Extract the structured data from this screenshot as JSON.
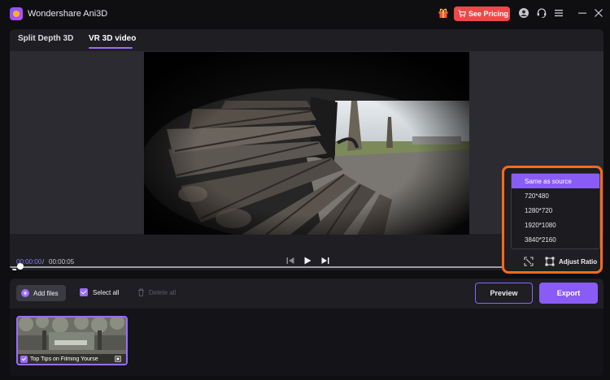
{
  "app": {
    "title": "Wondershare Ani3D",
    "pricing_label": "See Pricing"
  },
  "tabs": [
    {
      "label": "Split Depth 3D",
      "active": false
    },
    {
      "label": "VR 3D video",
      "active": true
    }
  ],
  "player": {
    "current_time": "00:00:00",
    "separator": "/",
    "total_time": "00:00:05",
    "progress": 0.0
  },
  "resolution_menu": {
    "options": [
      "Same as source",
      "720*480",
      "1280*720",
      "1920*1080",
      "3840*2160"
    ],
    "selected": "Same as source",
    "adjust_ratio_label": "Adjust Ratio"
  },
  "toolbar": {
    "add_files_label": "Add files",
    "select_all_label": "Select all",
    "delete_all_label": "Delete all",
    "preview_label": "Preview",
    "export_label": "Export"
  },
  "clips": [
    {
      "name": "Top Tips on Filming Yourse",
      "checked": true
    }
  ],
  "colors": {
    "accent": "#8a5cf6",
    "highlight_border": "#ff6a1a",
    "pricing": "#f04848"
  }
}
